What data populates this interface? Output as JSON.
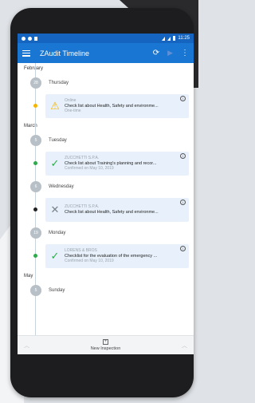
{
  "status_bar": {
    "time": "11:25"
  },
  "app_bar": {
    "title": "ZAudit Timeline",
    "icons": [
      "menu-icon",
      "refresh-icon",
      "play-icon",
      "more-icon"
    ]
  },
  "timeline": {
    "feb": {
      "month": "February",
      "day_badge": "28",
      "day_name": "Thursday",
      "item": {
        "top": "Online",
        "title": "Check list about Health, Safety and environme...",
        "bottom": "One-time",
        "status": "warning"
      }
    },
    "mar": {
      "month": "March"
    },
    "day1": {
      "day_badge": "5",
      "day_name": "Tuesday",
      "item": {
        "top": "ZUCCHETTI S.P.A.",
        "title": "Check list about Training's planning and recor...",
        "bottom": "Confirmed on May 10, 2019",
        "status": "confirmed"
      }
    },
    "day2": {
      "day_badge": "6",
      "day_name": "Wednesday",
      "item": {
        "top": "ZUCCHETTI S.P.A.",
        "title": "Check list about Health, Safety and environme...",
        "bottom": "",
        "status": "cancelled"
      }
    },
    "day3": {
      "day_badge": "19",
      "day_name": "Monday",
      "item": {
        "top": "LORENS & BROS",
        "title": "Checklist for the evaluation of the emergency ...",
        "bottom": "Confirmed on May 10, 2019",
        "status": "confirmed"
      }
    },
    "may": {
      "month": "May",
      "day_badge": "5",
      "day_name": "Sunday"
    }
  },
  "bottom_bar": {
    "label": "New Inspection"
  },
  "colors": {
    "primary": "#1976d2",
    "status_bar": "#1565c0",
    "warning": "#f5b400",
    "confirmed": "#2eaa4b",
    "cancelled": "#222222",
    "card": "#e8f1fb"
  }
}
